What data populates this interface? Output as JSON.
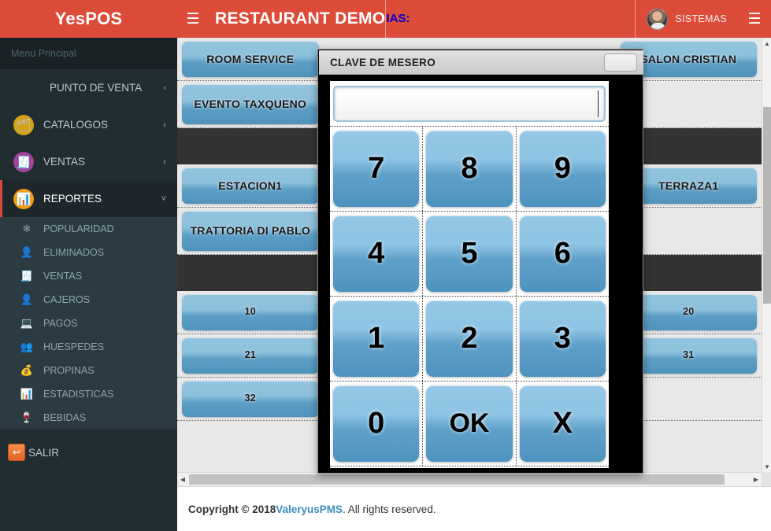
{
  "sidebar": {
    "brand": "YesPOS",
    "menu_header": "Menu Principal",
    "items": [
      {
        "label": "PUNTO DE VENTA",
        "icon": "",
        "arrow": "‹",
        "active": false
      },
      {
        "label": "CATALOGOS",
        "icon": "🗂",
        "arrow": "‹",
        "active": false
      },
      {
        "label": "VENTAS",
        "icon": "🧾",
        "arrow": "‹",
        "active": false
      },
      {
        "label": "REPORTES",
        "icon": "📊",
        "arrow": "˅",
        "active": true
      }
    ],
    "sub_items": [
      {
        "label": "POPULARIDAD",
        "icon": "❄"
      },
      {
        "label": "ELIMINADOS",
        "icon": "👤"
      },
      {
        "label": "VENTAS",
        "icon": "🧾"
      },
      {
        "label": "CAJEROS",
        "icon": "👤"
      },
      {
        "label": "PAGOS",
        "icon": "💻"
      },
      {
        "label": "HUESPEDES",
        "icon": "👥"
      },
      {
        "label": "PROPINAS",
        "icon": "💰"
      },
      {
        "label": "ESTADISTICAS",
        "icon": "📊"
      },
      {
        "label": "BEBIDAS",
        "icon": "🍷"
      }
    ],
    "logout": {
      "label": "SALIR",
      "icon": "↩"
    }
  },
  "header": {
    "hamburger_icon": "☰",
    "title": "RESTAURANT DEMO",
    "blue_text": "IAS:",
    "user_name": "SISTEMAS",
    "right_toggle_icon": "☰",
    "accent_color": "#dd4b39"
  },
  "grid": {
    "rows": [
      {
        "type": "buttons",
        "tall": false,
        "cells": [
          "ROOM SERVICE",
          "",
          "",
          "SALON CRISTIAN"
        ]
      },
      {
        "type": "buttons",
        "tall": true,
        "cells": [
          "EVENTO TAXQUENO",
          "",
          "",
          ""
        ]
      },
      {
        "type": "separator",
        "cells": []
      },
      {
        "type": "buttons",
        "tall": false,
        "cells": [
          "ESTACION1",
          "",
          "",
          "TERRAZA1"
        ]
      },
      {
        "type": "buttons",
        "tall": true,
        "cells": [
          "TRATTORIA DI PABLO",
          "",
          "",
          ""
        ]
      },
      {
        "type": "separator",
        "cells": []
      },
      {
        "type": "buttons",
        "tall": false,
        "cells": [
          "10",
          "",
          "",
          "20"
        ]
      },
      {
        "type": "buttons",
        "tall": false,
        "cells": [
          "21",
          "",
          "",
          "31"
        ]
      },
      {
        "type": "buttons",
        "tall": false,
        "cells": [
          "32",
          "",
          "",
          ""
        ]
      }
    ],
    "vscroll": {
      "up_icon": "▲",
      "down_icon": "▼"
    },
    "hscroll": {
      "left_icon": "◀",
      "right_icon": "▶"
    }
  },
  "modal": {
    "title": "CLAVE DE MESERO",
    "close_label": "",
    "input_value": "",
    "keypad": [
      [
        "7",
        "8",
        "9"
      ],
      [
        "4",
        "5",
        "6"
      ],
      [
        "1",
        "2",
        "3"
      ],
      [
        "0",
        "OK",
        "X"
      ]
    ]
  },
  "footer": {
    "prefix": "Copyright © 2018 ",
    "link": "ValeryusPMS",
    "suffix": ". All rights reserved."
  }
}
